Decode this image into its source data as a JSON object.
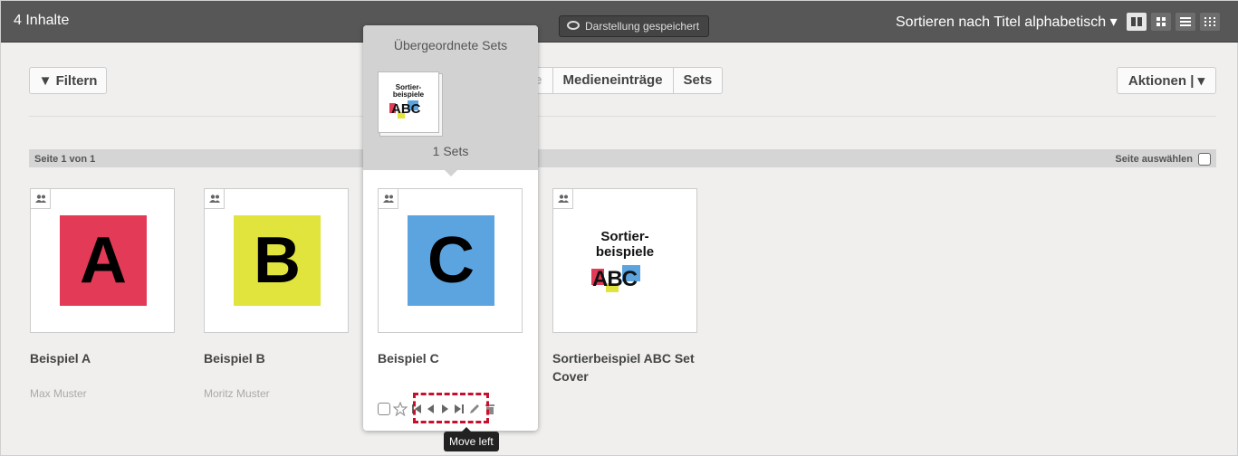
{
  "topbar": {
    "count_label": "4 Inhalte",
    "saved_label": "Darstellung gespeichert",
    "sort_label": "Sortieren nach Titel alphabetisch ▾",
    "view_icons": [
      "columns-icon",
      "grid-icon",
      "list-icon",
      "tiles-icon"
    ]
  },
  "toolbar": {
    "filter_label": "▼ Filtern",
    "tabs": [
      "le",
      "Medieneinträge",
      "Sets"
    ],
    "actions_label": "Aktionen | ▾"
  },
  "pager": {
    "label": "Seite 1 von 1",
    "select_label": "Seite auswählen"
  },
  "items": [
    {
      "title": "Beispiel A",
      "author": "Max Muster",
      "thumb_letter": "A",
      "thumb_color": "#e33b57"
    },
    {
      "title": "Beispiel B",
      "author": "Moritz Muster",
      "thumb_letter": "B",
      "thumb_color": "#e1e43c"
    },
    {
      "title": "Beispiel C",
      "author": "",
      "thumb_letter": "C",
      "thumb_color": "#5ca4e0"
    },
    {
      "title": "Sortierbeispiel ABC Set Cover",
      "author": "",
      "cover_text": "Sortier-\nbeispiele",
      "cover_abc": "ABC"
    }
  ],
  "popover": {
    "title": "Übergeordnete Sets",
    "mini_text": "Sortier-\nbeispiele",
    "mini_abc": "ABC",
    "count_label": "1 Sets"
  },
  "tooltip": {
    "label": "Move left"
  },
  "colors": {
    "topbar": "#575757",
    "highlight": "#c8102e",
    "background": "#f0efee"
  }
}
